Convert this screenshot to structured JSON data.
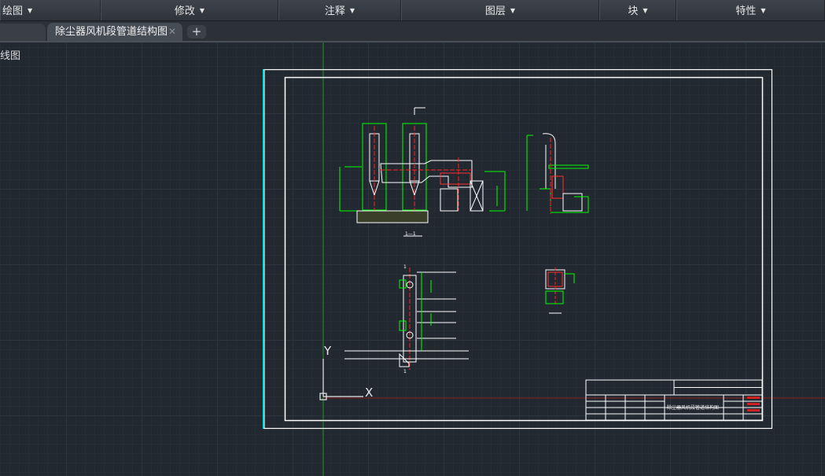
{
  "ribbon": {
    "panels": [
      {
        "label": "绘图"
      },
      {
        "label": "修改"
      },
      {
        "label": "注释"
      },
      {
        "label": "图层"
      },
      {
        "label": "块"
      },
      {
        "label": "特性"
      }
    ]
  },
  "tabs": {
    "active_label": "除尘器风机段管道结构图",
    "close_glyph": "✕",
    "add_glyph": "+"
  },
  "viewport": {
    "label": "线图",
    "ucs_y": "Y",
    "ucs_x": "X"
  },
  "drawing": {
    "title_block_title": "除尘器风机段管道结构图",
    "section_mark": "1—1"
  },
  "colors": {
    "background": "#212830",
    "frame": "#ffffff",
    "paper_edge": "#00ffff",
    "geometry": "#00ff00",
    "centerline": "#ff0000"
  }
}
